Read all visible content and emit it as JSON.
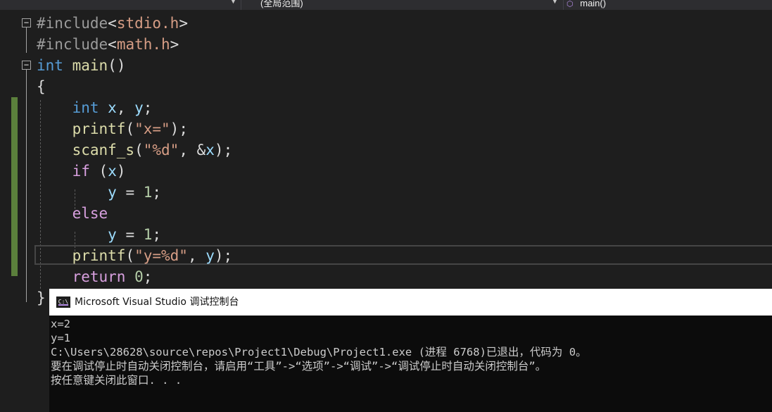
{
  "navbar": {
    "scope": "(全局范围)",
    "member": "main()",
    "member_icon": "cube-icon"
  },
  "code": {
    "line1": {
      "directive": "#include",
      "open": "<",
      "header": "stdio.h",
      "close": ">"
    },
    "line2": {
      "directive": "#include",
      "open": "<",
      "header": "math.h",
      "close": ">"
    },
    "line3": {
      "type": "int",
      "name": "main",
      "parens": "()"
    },
    "line4": {
      "brace": "{"
    },
    "line5": {
      "type": "int",
      "var_x": "x",
      "comma": ",",
      "var_y": "y",
      "semi": ";"
    },
    "line6": {
      "fn": "printf",
      "open": "(",
      "str": "\"x=\"",
      "close": ");"
    },
    "line7": {
      "fn": "scanf_s",
      "open": "(",
      "str": "\"%d\"",
      "mid": ", &",
      "var": "x",
      "close": ");"
    },
    "line8": {
      "kw": "if",
      "open": "(",
      "var": "x",
      "close": ")"
    },
    "line9": {
      "var": "y",
      "op": " = ",
      "num": "1",
      "semi": ";"
    },
    "line10": {
      "kw": "else"
    },
    "line11": {
      "var": "y",
      "op": " = ",
      "num": "1",
      "semi": ";"
    },
    "line12": {
      "fn": "printf",
      "open": "(",
      "str": "\"y=%d\"",
      "mid": ", ",
      "var": "y",
      "close": ");"
    },
    "line13": {
      "kw": "return",
      "num": "0",
      "semi": ";"
    },
    "line14": {
      "brace": "}"
    }
  },
  "console": {
    "title": "Microsoft Visual Studio 调试控制台",
    "icon_label": "C:\\",
    "lines": [
      "x=2",
      "y=1",
      "C:\\Users\\28628\\source\\repos\\Project1\\Debug\\Project1.exe (进程 6768)已退出，代码为 0。",
      "要在调试停止时自动关闭控制台，请启用“工具”->“选项”->“调试”->“调试停止时自动关闭控制台”。",
      "按任意键关闭此窗口. . ."
    ]
  },
  "colors": {
    "editor_bg": "#1e1e1e",
    "keyword": "#569cd6",
    "function": "#dcdcaa",
    "string": "#d69d85",
    "variable": "#9cdcfe",
    "number": "#b5cea8",
    "control": "#d8a0df",
    "change_bar": "#5b7f3c",
    "console_bg": "#0c0c0c"
  }
}
